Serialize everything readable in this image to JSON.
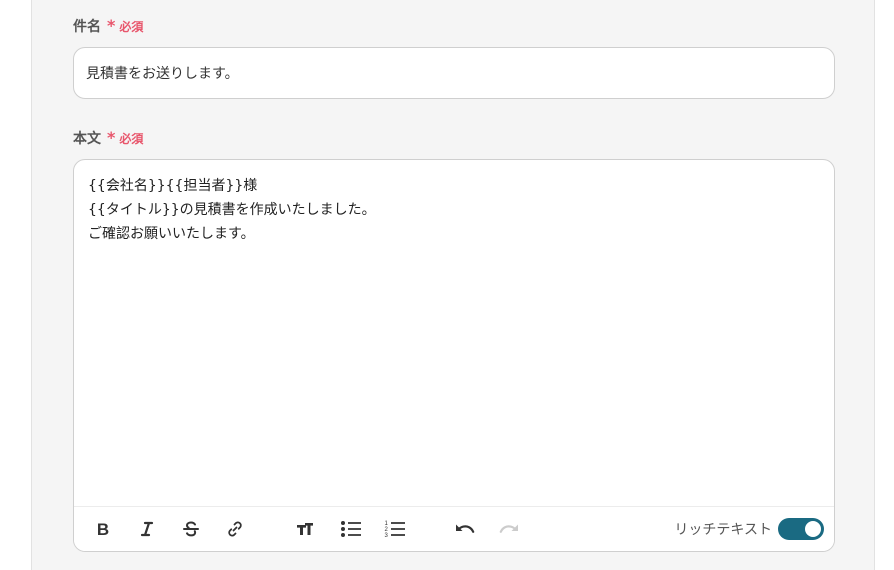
{
  "subject": {
    "label": "件名",
    "required_mark": "*",
    "required_text": "必須",
    "value": "見積書をお送りします。"
  },
  "body": {
    "label": "本文",
    "required_mark": "*",
    "required_text": "必須",
    "lines": [
      "{{会社名}}{{担当者}}様",
      "{{タイトル}}の見積書を作成いたしました。",
      "ご確認お願いいたします。"
    ]
  },
  "toolbar": {
    "buttons": [
      {
        "name": "bold-icon"
      },
      {
        "name": "italic-icon"
      },
      {
        "name": "strikethrough-icon"
      },
      {
        "name": "link-icon"
      },
      {
        "name": "text-size-icon"
      },
      {
        "name": "bulleted-list-icon"
      },
      {
        "name": "numbered-list-icon"
      },
      {
        "name": "undo-icon"
      },
      {
        "name": "redo-icon",
        "disabled": true
      }
    ],
    "rich_text_label": "リッチテキスト",
    "rich_text_enabled": true
  },
  "colors": {
    "required": "#e8566c",
    "toggle_on": "#1a6a82",
    "panel_bg": "#f5f5f5"
  }
}
